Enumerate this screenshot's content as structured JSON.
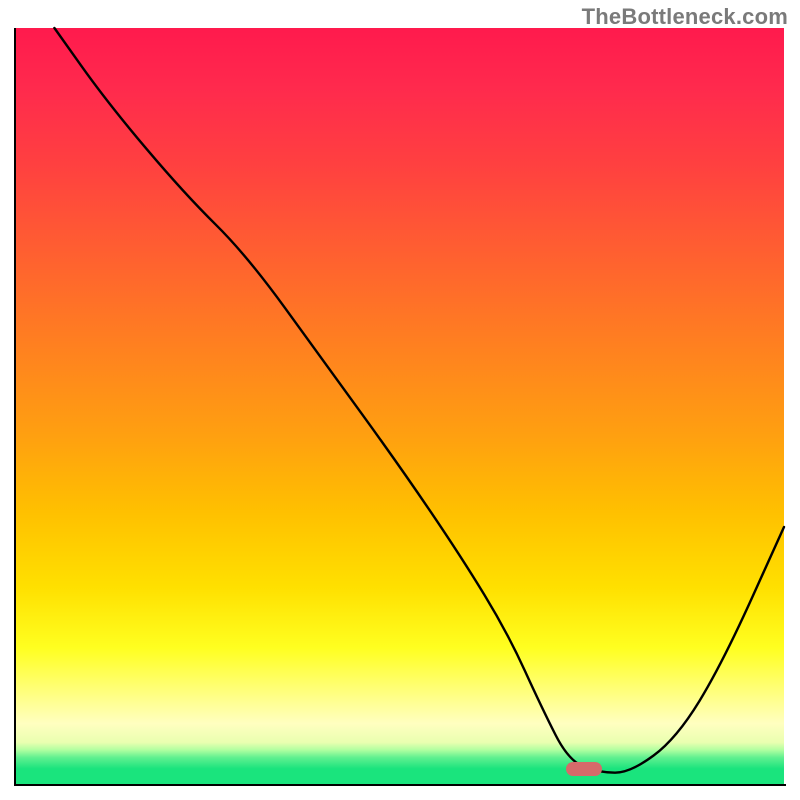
{
  "watermark": "TheBottleneck.com",
  "chart_data": {
    "type": "line",
    "title": "",
    "xlabel": "",
    "ylabel": "",
    "xlim": [
      0,
      100
    ],
    "ylim": [
      0,
      100
    ],
    "series": [
      {
        "name": "curve",
        "x": [
          5,
          12,
          22,
          30,
          40,
          50,
          58,
          64,
          68.5,
          72,
          76,
          80,
          86,
          92,
          100
        ],
        "y": [
          100,
          90,
          78,
          70,
          56,
          42,
          30,
          20,
          10,
          3,
          1.5,
          1.5,
          6,
          16,
          34
        ]
      }
    ],
    "marker": {
      "x": 74,
      "y": 2
    },
    "background_gradient": {
      "top": "#ff1a4d",
      "mid1": "#ff8020",
      "mid2": "#ffff20",
      "bottom": "#1ae47d"
    }
  }
}
